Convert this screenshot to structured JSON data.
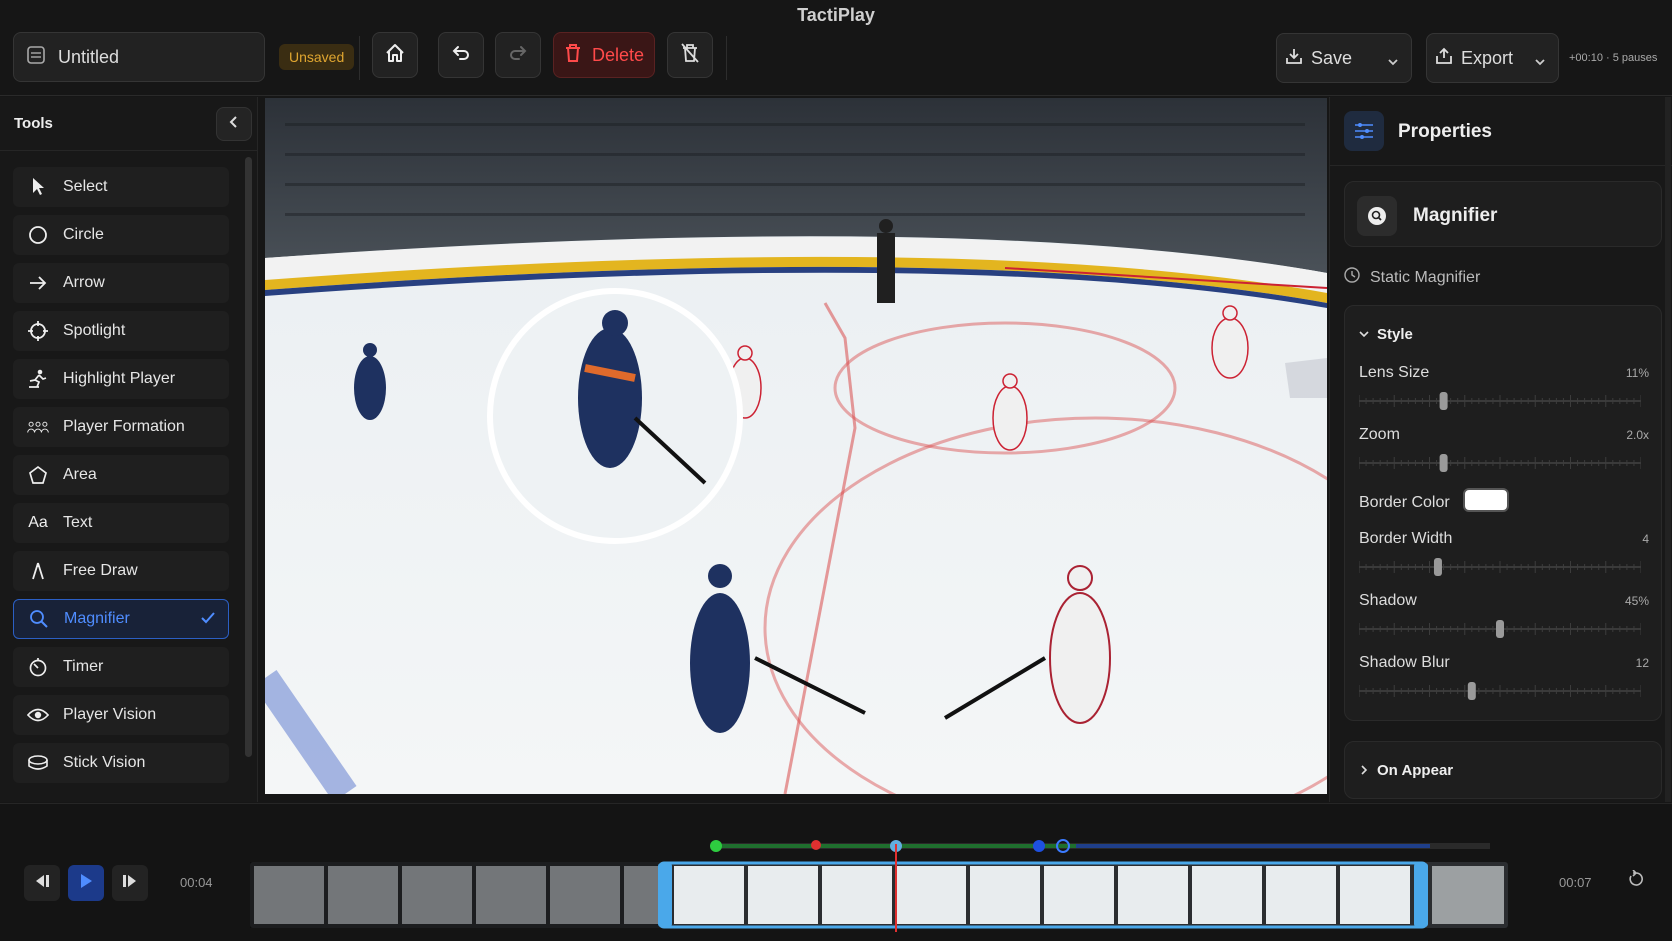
{
  "app": {
    "title": "TactiPlay"
  },
  "topbar": {
    "doc_title": "Untitled",
    "status": "Unsaved",
    "delete_label": "Delete",
    "save_label": "Save",
    "export_label": "Export",
    "meta": "+00:10 · 5 pauses"
  },
  "sidebar": {
    "title": "Tools",
    "items": [
      {
        "label": "Select",
        "icon": "cursor-icon"
      },
      {
        "label": "Circle",
        "icon": "circle-icon"
      },
      {
        "label": "Arrow",
        "icon": "arrow-icon"
      },
      {
        "label": "Spotlight",
        "icon": "spotlight-icon"
      },
      {
        "label": "Highlight Player",
        "icon": "skater-icon"
      },
      {
        "label": "Player Formation",
        "icon": "group-icon"
      },
      {
        "label": "Area",
        "icon": "pentagon-icon"
      },
      {
        "label": "Text",
        "icon": "text-icon"
      },
      {
        "label": "Free Draw",
        "icon": "pen-icon"
      },
      {
        "label": "Magnifier",
        "icon": "magnifier-icon",
        "active": true
      },
      {
        "label": "Timer",
        "icon": "timer-icon"
      },
      {
        "label": "Player Vision",
        "icon": "eye-icon"
      },
      {
        "label": "Stick Vision",
        "icon": "stick-icon"
      }
    ]
  },
  "properties": {
    "title": "Properties",
    "tool_name": "Magnifier",
    "subtitle": "Static Magnifier",
    "style_title": "Style",
    "rows": [
      {
        "label": "Lens Size",
        "value": "11%",
        "level": 0.3
      },
      {
        "label": "Zoom",
        "value": "2.0x",
        "level": 0.3
      },
      {
        "label": "Border Width",
        "value": "4",
        "level": 0.28
      },
      {
        "label": "Shadow",
        "value": "45%",
        "level": 0.5
      },
      {
        "label": "Shadow Blur",
        "value": "12",
        "level": 0.4
      }
    ],
    "border_color_label": "Border Color",
    "border_color": "#ffffff",
    "on_appear_title": "On Appear"
  },
  "timeline": {
    "current_time": "00:04",
    "end_time": "00:07"
  },
  "colors": {
    "accent": "#2f6fe4",
    "danger": "#ff4a4a",
    "warning": "#e0a630"
  }
}
